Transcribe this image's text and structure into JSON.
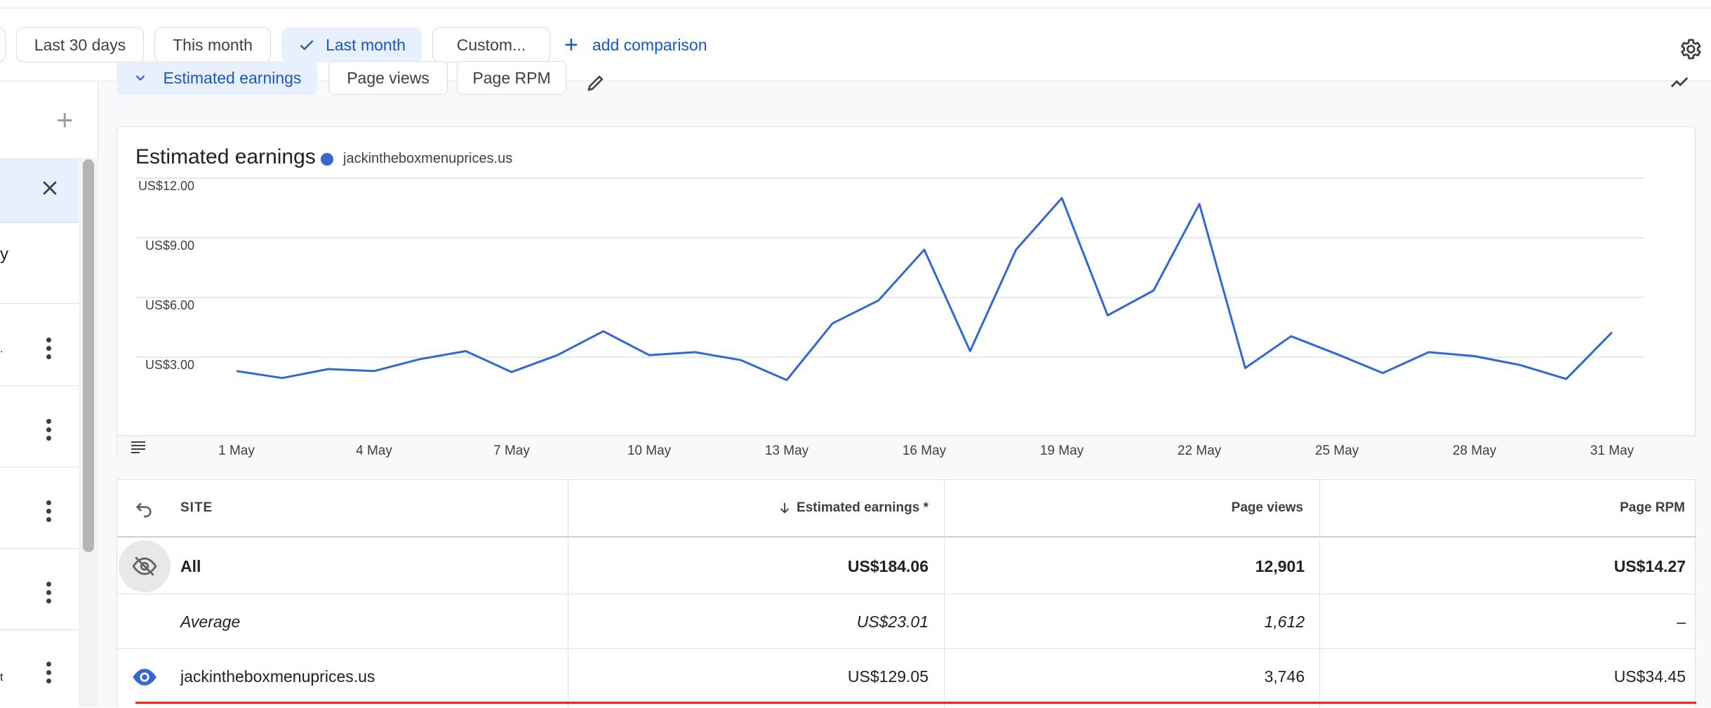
{
  "toolbar": {
    "chips": [
      {
        "label": "Last 30 days",
        "selected": false
      },
      {
        "label": "This month",
        "selected": false
      },
      {
        "label": "Last month",
        "selected": true
      },
      {
        "label": "Custom..."
      }
    ],
    "add_comparison": "add comparison"
  },
  "metrics": {
    "estimated_earnings": "Estimated earnings",
    "page_views": "Page views",
    "page_rpm": "Page RPM"
  },
  "left_panel": {
    "fragments": [
      "y",
      ".",
      "t"
    ]
  },
  "chart": {
    "title": "Estimated earnings",
    "legend": "jackintheboxmenuprices.us"
  },
  "chart_data": {
    "type": "line",
    "title": "Estimated earnings",
    "series": [
      {
        "name": "jackintheboxmenuprices.us",
        "color": "#3367d6",
        "values": [
          2.9,
          2.55,
          3.0,
          2.9,
          3.5,
          3.9,
          2.85,
          3.7,
          4.9,
          3.7,
          3.85,
          3.45,
          2.45,
          5.3,
          6.45,
          9.0,
          3.9,
          9.0,
          11.6,
          5.7,
          6.95,
          11.3,
          3.05,
          4.65,
          3.75,
          2.8,
          3.85,
          3.65,
          3.2,
          2.5,
          4.85
        ]
      }
    ],
    "x": [
      "1 May",
      "2 May",
      "3 May",
      "4 May",
      "5 May",
      "6 May",
      "7 May",
      "8 May",
      "9 May",
      "10 May",
      "11 May",
      "12 May",
      "13 May",
      "14 May",
      "15 May",
      "16 May",
      "17 May",
      "18 May",
      "19 May",
      "20 May",
      "21 May",
      "22 May",
      "23 May",
      "24 May",
      "25 May",
      "26 May",
      "27 May",
      "28 May",
      "29 May",
      "30 May",
      "31 May"
    ],
    "x_tick_labels": [
      "1 May",
      "4 May",
      "7 May",
      "10 May",
      "13 May",
      "16 May",
      "19 May",
      "22 May",
      "25 May",
      "28 May",
      "31 May"
    ],
    "y_tick_labels": [
      "US$3.00",
      "US$6.00",
      "US$9.00",
      "US$12.00"
    ],
    "y_ticks": [
      3,
      6,
      9,
      12
    ],
    "ylim": [
      0,
      12.7
    ],
    "grid": true
  },
  "table": {
    "headers": {
      "site": "SITE",
      "earnings": "Estimated earnings *",
      "page_views": "Page views",
      "page_rpm": "Page RPM"
    },
    "rows": [
      {
        "site": "All",
        "earnings": "US$184.06",
        "page_views": "12,901",
        "page_rpm": "US$14.27",
        "style": "bold"
      },
      {
        "site": "Average",
        "earnings": "US$23.01",
        "page_views": "1,612",
        "page_rpm": "–",
        "style": "italic"
      },
      {
        "site": "jackintheboxmenuprices.us",
        "earnings": "US$129.05",
        "page_views": "3,746",
        "page_rpm": "US$34.45",
        "style": "normal"
      }
    ]
  },
  "colors": {
    "accent": "#1a56c7",
    "series": "#3367d6",
    "selected_bg": "#e8f0fe",
    "row_marker": "#d93025"
  }
}
